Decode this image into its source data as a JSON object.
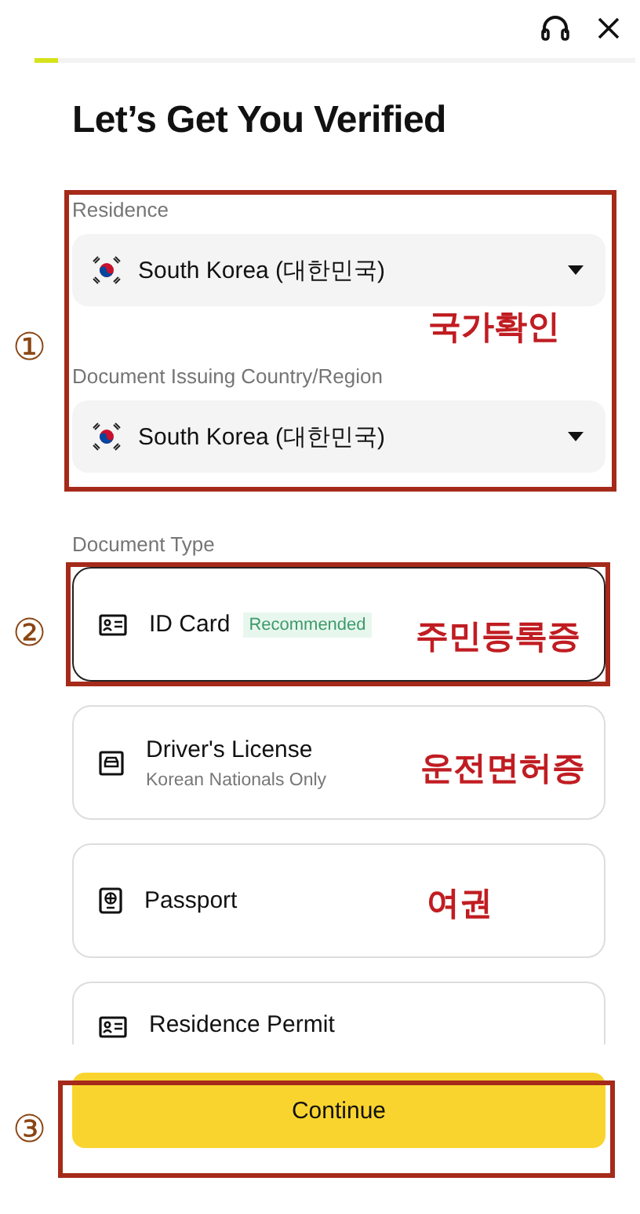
{
  "progress": {
    "level": 0.04
  },
  "title": "Let’s Get You Verified",
  "fields": [
    {
      "label": "Residence",
      "value": "South Korea (대한민국)"
    },
    {
      "label": "Document Issuing Country/Region",
      "value": "South Korea (대한민국)"
    }
  ],
  "document_type": {
    "label": "Document Type",
    "options": [
      {
        "kind": "id",
        "name": "ID Card",
        "badge": "Recommended",
        "selected": true
      },
      {
        "kind": "car",
        "name": "Driver's License",
        "note": "Korean Nationals Only",
        "selected": false
      },
      {
        "kind": "passport",
        "name": "Passport",
        "selected": false
      },
      {
        "kind": "id",
        "name": "Residence Permit",
        "selected": false
      }
    ]
  },
  "continue_button": "Continue",
  "annotations": [
    {
      "number": "①",
      "notes": [
        "국가확인"
      ]
    },
    {
      "number": "②",
      "notes": [
        "주민등록증",
        "운전면허증",
        "여권"
      ]
    },
    {
      "number": "③"
    }
  ]
}
